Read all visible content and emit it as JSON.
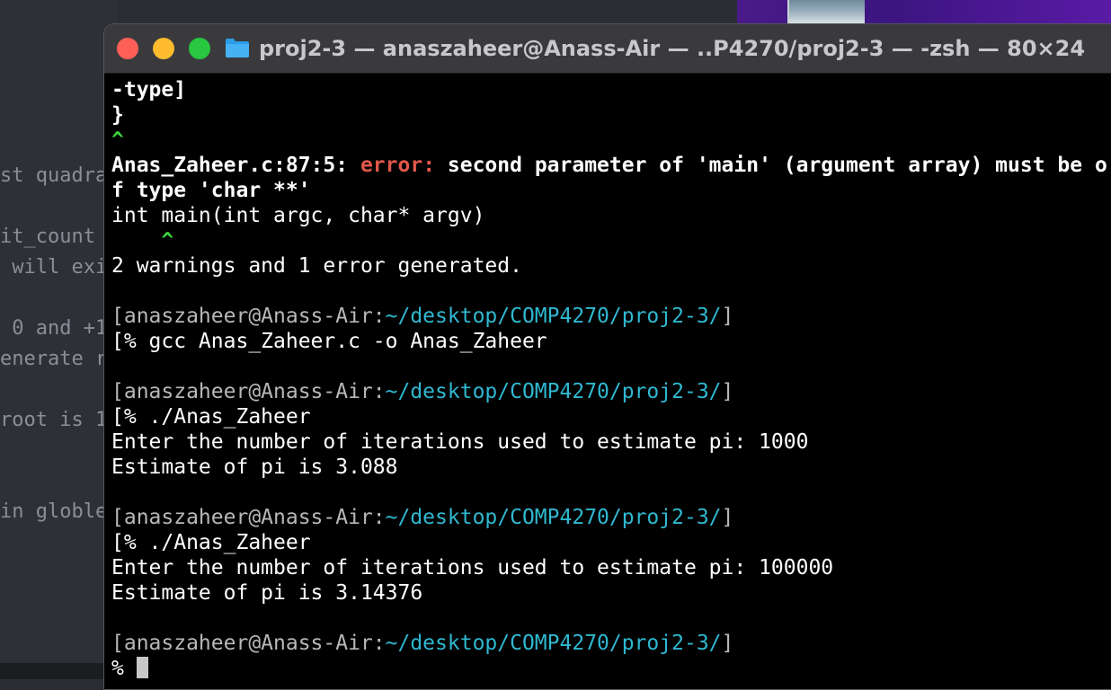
{
  "background_editor": {
    "lines": [
      "st quadra",
      "it_count",
      " will exi",
      " 0 and +1",
      "enerate r",
      "root is 1",
      "in globle"
    ]
  },
  "terminal": {
    "title": "proj2-3 — anaszaheer@Anass-Air — ..P4270/proj2-3 — -zsh — 80×24",
    "lines": {
      "l1": "-type]",
      "l2": "}",
      "l3": "^",
      "l4_file": "Anas_Zaheer.c:87:5: ",
      "l4_error": "error: ",
      "l4_msg": "second parameter of 'main' (argument array) must be o",
      "l5": "f type 'char **'",
      "l6": "int main(int argc, char* argv)",
      "l7": "    ^",
      "l8": "2 warnings and 1 error generated.",
      "prompt1_user": "[anaszaheer@Anass-Air:",
      "prompt1_path": "~/desktop/COMP4270/proj2-3/",
      "prompt1_end": "]",
      "cmd1": "[% gcc Anas_Zaheer.c -o Anas_Zaheer",
      "prompt2_user": "[anaszaheer@Anass-Air:",
      "prompt2_path": "~/desktop/COMP4270/proj2-3/",
      "prompt2_end": "]",
      "cmd2": "[% ./Anas_Zaheer",
      "out2a": "Enter the number of iterations used to estimate pi: 1000",
      "out2b": "Estimate of pi is 3.088",
      "prompt3_user": "[anaszaheer@Anass-Air:",
      "prompt3_path": "~/desktop/COMP4270/proj2-3/",
      "prompt3_end": "]",
      "cmd3": "[% ./Anas_Zaheer",
      "out3a": "Enter the number of iterations used to estimate pi: 100000",
      "out3b": "Estimate of pi is 3.14376",
      "prompt4_user": "[anaszaheer@Anass-Air:",
      "prompt4_path": "~/desktop/COMP4270/proj2-3/",
      "prompt4_end": "]",
      "cmd4": "% "
    }
  },
  "colors": {
    "error": "#e0584a",
    "caret": "#3ed33e",
    "path": "#2fb8d0",
    "prompt": "#b8b8b8"
  }
}
